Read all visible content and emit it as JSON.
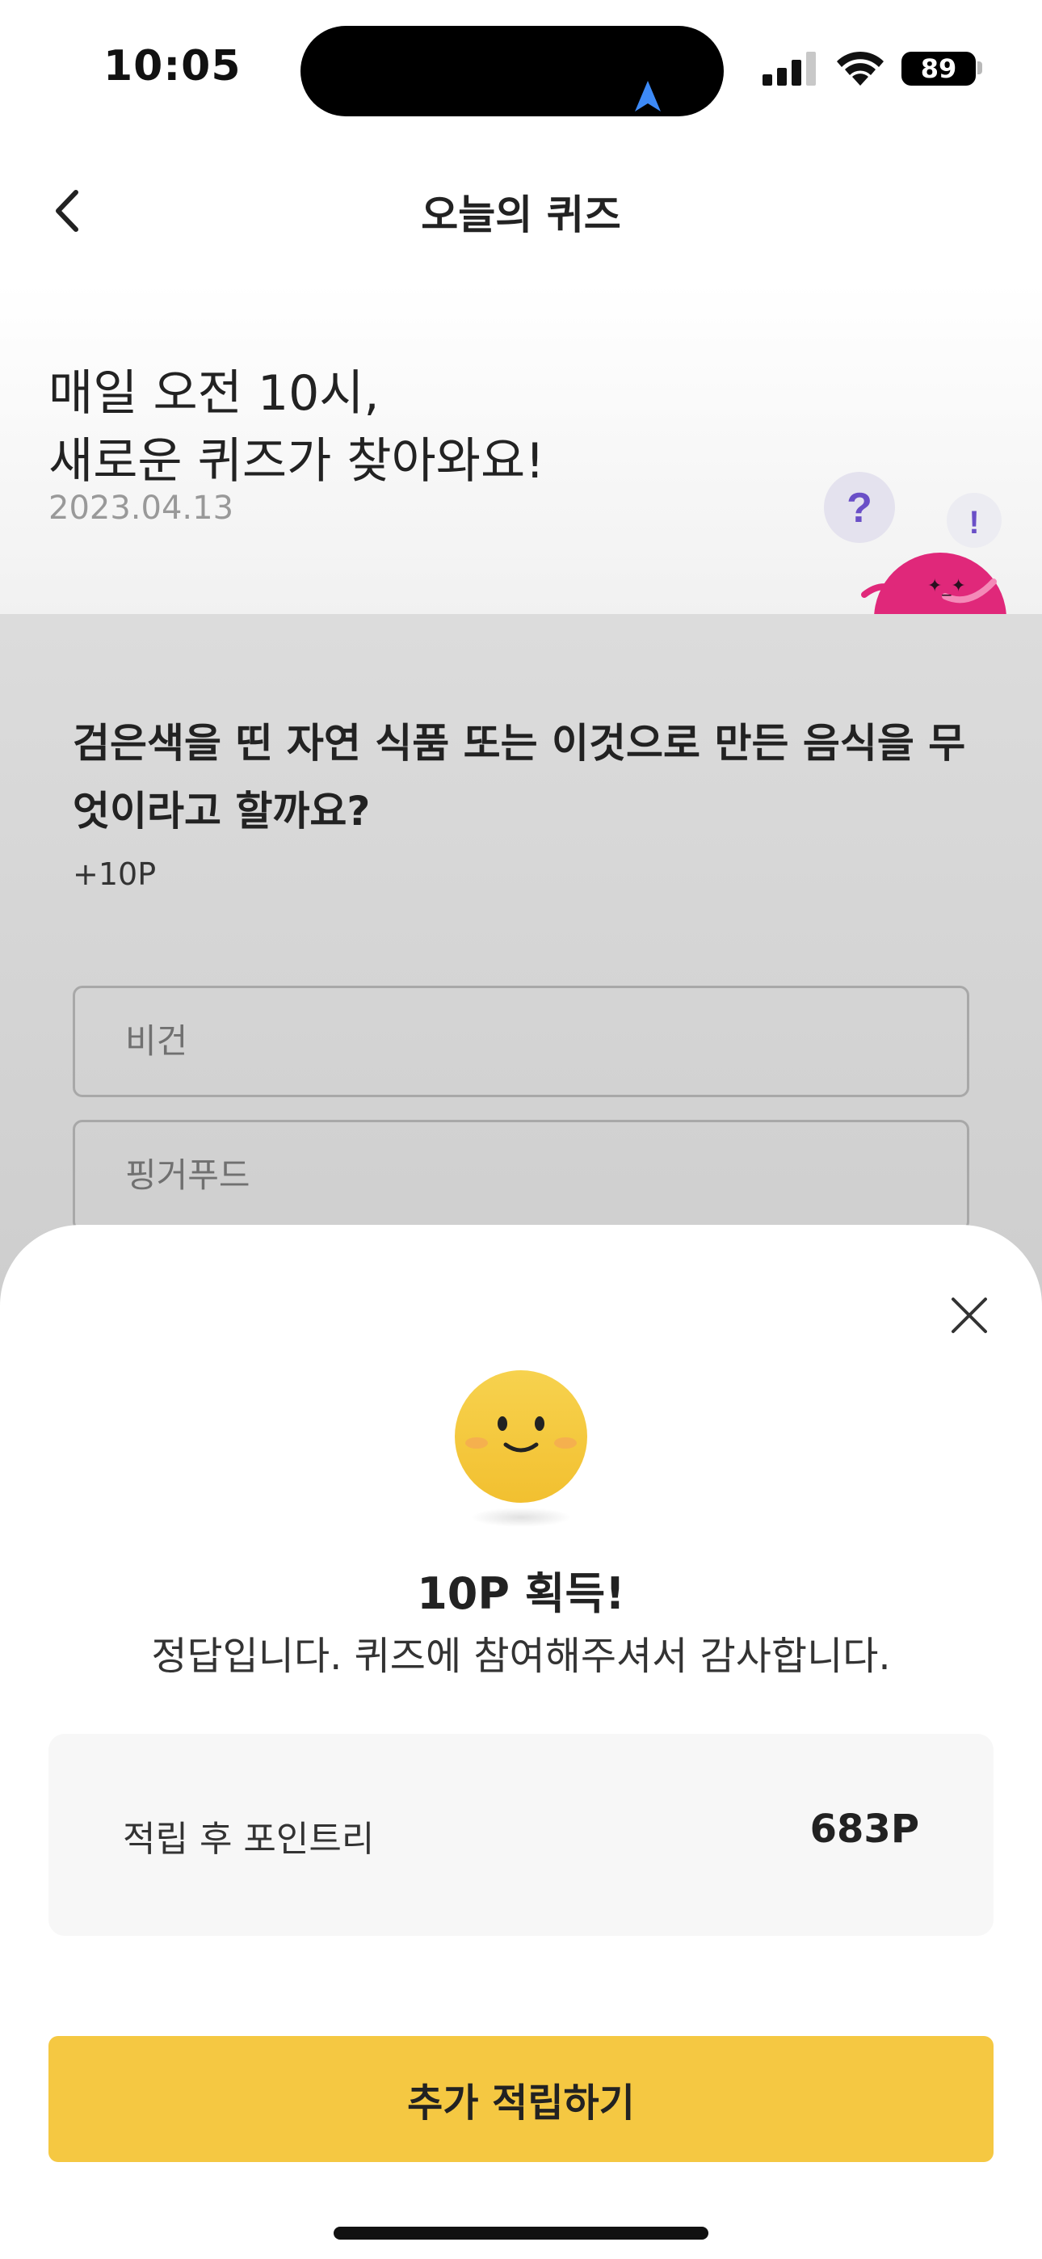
{
  "status_bar": {
    "time": "10:05",
    "battery": "89",
    "icons": [
      "location-arrow-icon",
      "cellular-signal-icon",
      "wifi-icon",
      "battery-icon"
    ]
  },
  "header": {
    "title": "오늘의 퀴즈",
    "back_icon": "chevron-left-icon"
  },
  "hero": {
    "line1": "매일 오전 10시,",
    "line2": "새로운 퀴즈가 찾아와요!",
    "date": "2023.04.13",
    "bubble_question": "?",
    "bubble_exclaim": "!"
  },
  "quiz": {
    "question": "검은색을 띤 자연 식품 또는 이것으로 만든 음식을 무엇이라고 할까요?",
    "reward": "+10P",
    "options": [
      "비건",
      "핑거푸드"
    ]
  },
  "result_sheet": {
    "close_icon": "close-icon",
    "smiley_icon": "smiley-face-icon",
    "title": "10P 획득!",
    "message": "정답입니다. 퀴즈에 참여해주셔서 감사합니다.",
    "balance_label": "적립 후 포인트리",
    "balance_value": "683P",
    "cta_label": "추가 적립하기"
  },
  "colors": {
    "accent_yellow": "#f5c842",
    "mascot_pink": "#e0287a",
    "nav_blue": "#3d8af7",
    "bubble_purple": "#6a4fc7"
  }
}
